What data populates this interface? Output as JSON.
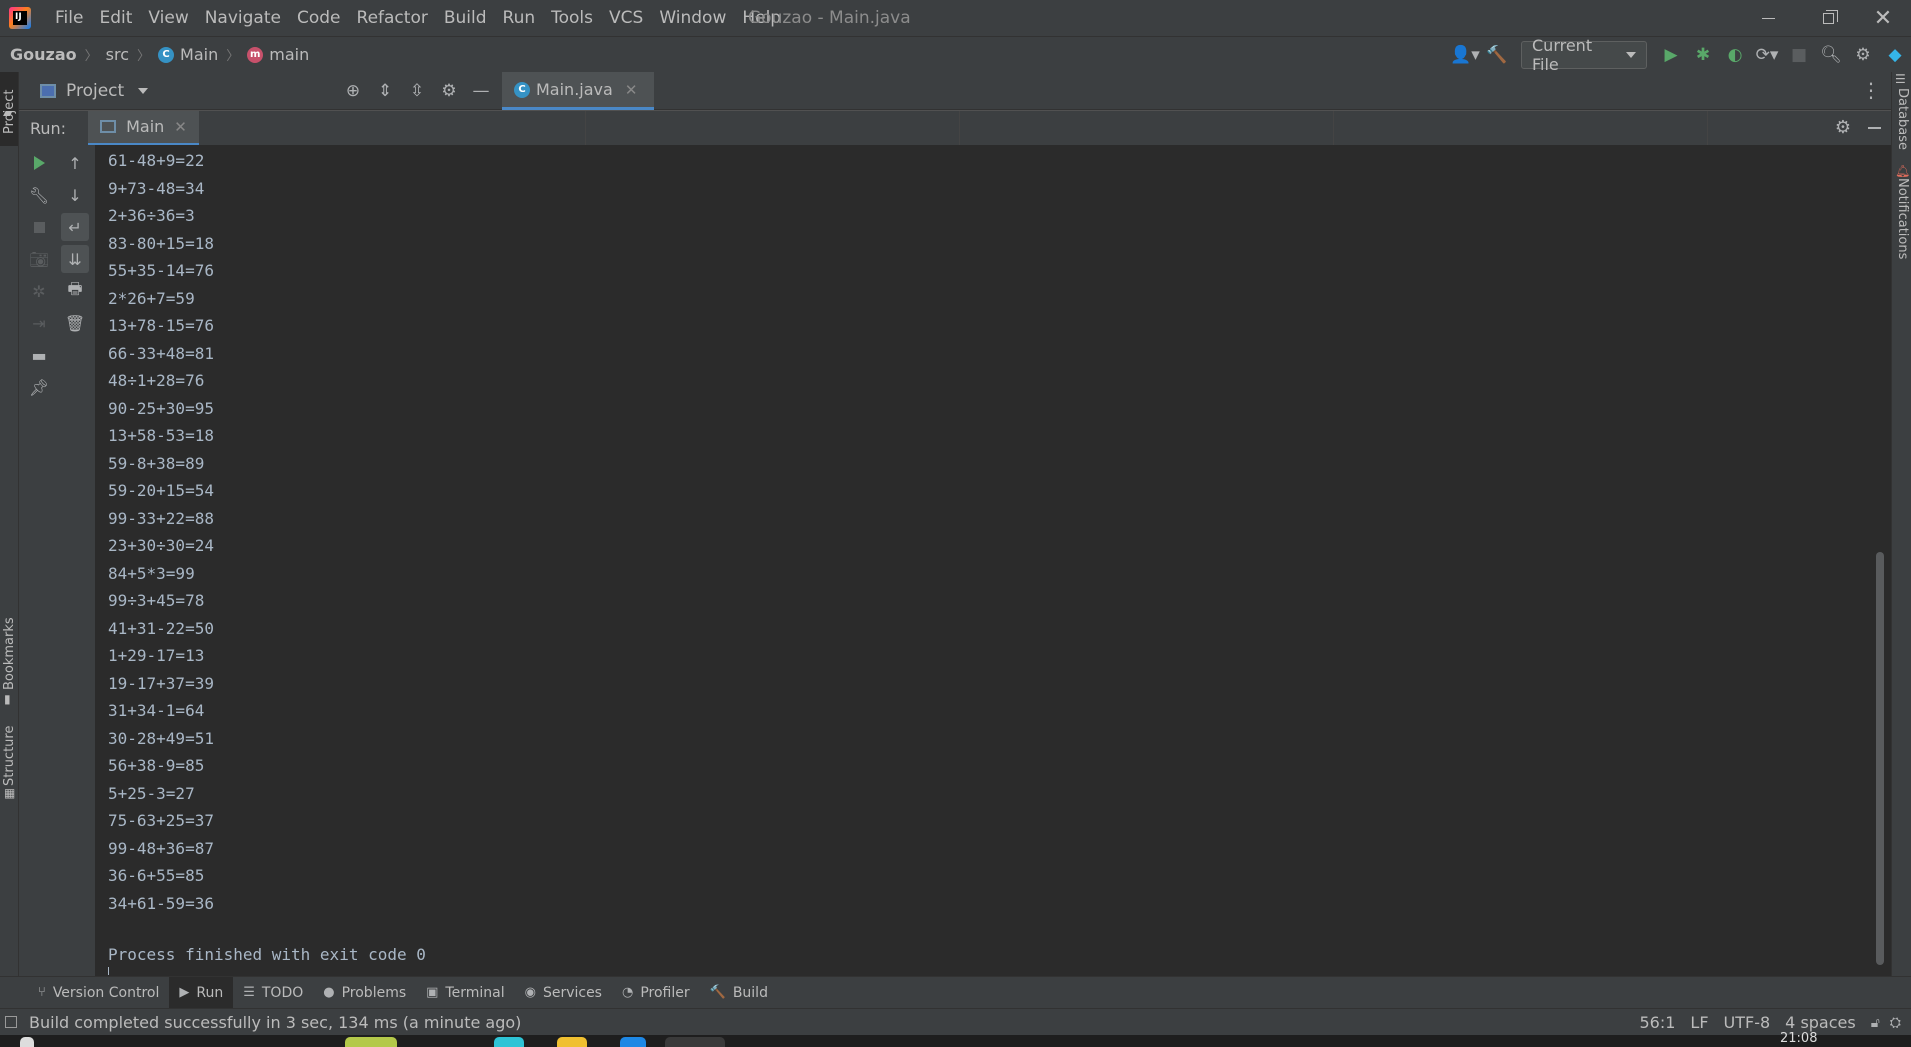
{
  "window": {
    "title": "Gouzao - Main.java",
    "menu": [
      "File",
      "Edit",
      "View",
      "Navigate",
      "Code",
      "Refactor",
      "Build",
      "Run",
      "Tools",
      "VCS",
      "Window",
      "Help"
    ]
  },
  "navbar": {
    "project": "Gouzao",
    "path": [
      "src",
      "Main",
      "main"
    ],
    "run_config": "Current File"
  },
  "project_panel": {
    "title": "Project"
  },
  "editor_tab": {
    "label": "Main.java"
  },
  "run_panel": {
    "label": "Run:",
    "tab": "Main"
  },
  "console": {
    "lines": [
      "61-48+9=22",
      "9+73-48=34",
      "2+36÷36=3",
      "83-80+15=18",
      "55+35-14=76",
      "2*26+7=59",
      "13+78-15=76",
      "66-33+48=81",
      "48÷1+28=76",
      "90-25+30=95",
      "13+58-53=18",
      "59-8+38=89",
      "59-20+15=54",
      "99-33+22=88",
      "23+30÷30=24",
      "84+5*3=99",
      "99÷3+45=78",
      "41+31-22=50",
      "1+29-17=13",
      "19-17+37=39",
      "31+34-1=64",
      "30-28+49=51",
      "56+38-9=85",
      "5+25-3=27",
      "75-63+25=37",
      "99-48+36=87",
      "36-6+55=85",
      "34+61-59=36"
    ],
    "exit_message": "Process finished with exit code 0"
  },
  "side_labels": {
    "left_top": "Project",
    "left_bookmarks": "Bookmarks",
    "left_structure": "Structure",
    "right_database": "Database",
    "right_notifications": "Notifications"
  },
  "bottom_tabs": [
    "Version Control",
    "Run",
    "TODO",
    "Problems",
    "Terminal",
    "Services",
    "Profiler",
    "Build"
  ],
  "status": {
    "message": "Build completed successfully in 3 sec, 134 ms (a minute ago)",
    "position": "56:1",
    "line_ending": "LF",
    "encoding": "UTF-8",
    "indent": "4 spaces"
  },
  "taskbar": {
    "clock": "21:08"
  },
  "colors": {
    "background": "#2b2b2b",
    "panel": "#3c3f41",
    "accent": "#4a88c7",
    "run_green": "#59a869",
    "console_text": "#a9b7c6"
  }
}
